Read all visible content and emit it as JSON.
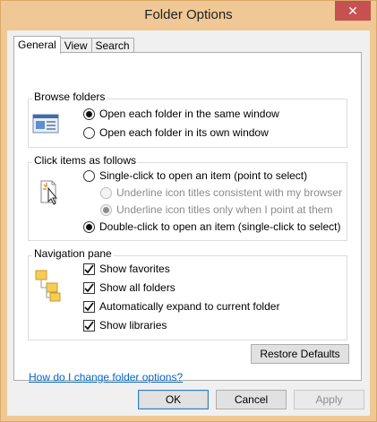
{
  "window": {
    "title": "Folder Options",
    "close_glyph": "✕"
  },
  "tabs": [
    {
      "label": "General"
    },
    {
      "label": "View"
    },
    {
      "label": "Search"
    }
  ],
  "browse": {
    "label": "Browse folders",
    "options": [
      "Open each folder in the same window",
      "Open each folder in its own window"
    ],
    "selected": 0
  },
  "click": {
    "label": "Click items as follows",
    "single": "Single-click to open an item (point to select)",
    "underline_browser": "Underline icon titles consistent with my browser",
    "underline_point": "Underline icon titles only when I point at them",
    "double": "Double-click to open an item (single-click to select)"
  },
  "nav": {
    "label": "Navigation pane",
    "items": [
      "Show favorites",
      "Show all folders",
      "Automatically expand to current folder",
      "Show libraries"
    ]
  },
  "buttons": {
    "restore": "Restore Defaults",
    "ok": "OK",
    "cancel": "Cancel",
    "apply": "Apply"
  },
  "help_link": "How do I change folder options?",
  "colors": {
    "titlebar": "#f0c896",
    "close": "#c75050",
    "link": "#0066cc"
  }
}
